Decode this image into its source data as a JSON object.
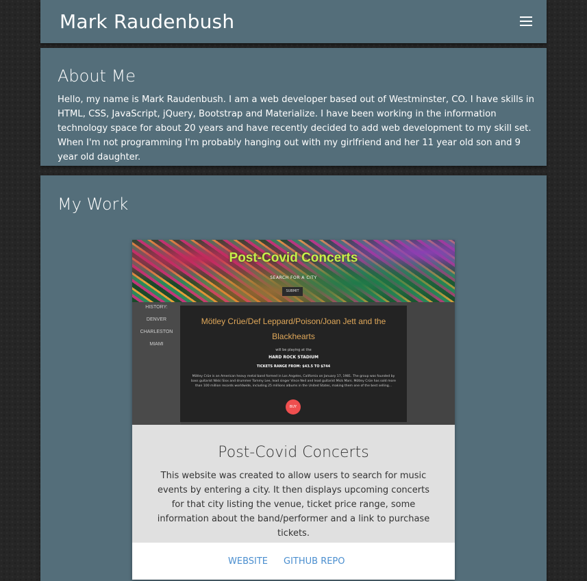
{
  "header": {
    "name": "Mark Raudenbush",
    "menu_icon": "hamburger-menu-icon"
  },
  "about": {
    "title": "About Me",
    "text": "Hello, my name is Mark Raudenbush. I am a web developer based out of Westminster, CO. I have skills in HTML, CSS, JavaScript, jQuery, Bootstrap and Materialize. I have been working in the information technology space for about 20 years and have recently decided to add web development to my skill set. When I'm not programming I'm probably hanging out with my girlfriend and her 11 year old son and 9 year old daughter."
  },
  "work": {
    "title": "My Work",
    "projects": [
      {
        "screenshot": {
          "hero_title": "Post-Covid Concerts",
          "search_label": "SEARCH FOR A CITY",
          "submit_label": "SUBMIT",
          "history": [
            "HISTORY:",
            "DENVER",
            "CHARLESTON",
            "MIAMI"
          ],
          "band": "Mötley Crüe/Def Leppard/Poison/Joan Jett and the Blackhearts",
          "will_play": "will be playing at the",
          "venue": "HARD ROCK STADIUM",
          "tickets": "TICKETS RANGE FROM: $43.5 TO $744",
          "bio": "Mötley Crüe is an American heavy metal band formed in Los Angeles, California on January 17, 1981. The group was founded by bass guitarist Nikki Sixx and drummer Tommy Lee, lead singer Vince Neil and lead guitarist Mick Mars. Mötley Crüe has sold more than 100 million records worldwide, including 25 millions albums in the United States, making them one of the best selling...",
          "buy_label": "BUY"
        },
        "title": "Post-Covid Concerts",
        "description": "This website was created to allow users to search for music events by entering a city. It then displays upcoming concerts for that city listing the venue, ticket price range, some information about the band/performer and a link to purchase tickets.",
        "links": {
          "website": "WEBSITE",
          "github": "GITHUB REPO"
        }
      }
    ]
  },
  "colors": {
    "panel": "#546e7a",
    "background": "#262626",
    "link": "#4a8ecf",
    "card_info": "#e0e0e0"
  }
}
